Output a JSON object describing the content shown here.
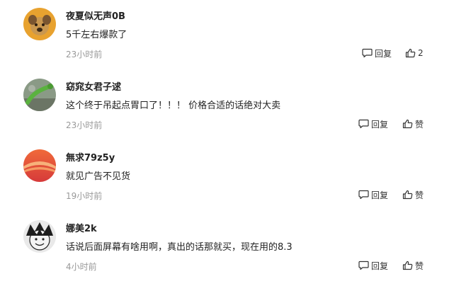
{
  "comments": [
    {
      "username": "夜夏似无声0B",
      "text": "5千左右爆款了",
      "time": "23小时前",
      "reply_label": "回复",
      "like_label": "2"
    },
    {
      "username": "窈窕女君子逑",
      "text": "这个终于吊起点胃口了！！！ 价格合适的话绝对大卖",
      "time": "23小时前",
      "reply_label": "回复",
      "like_label": "赞"
    },
    {
      "username": "無求79z5y",
      "text": "就见广告不见货",
      "time": "19小时前",
      "reply_label": "回复",
      "like_label": "赞"
    },
    {
      "username": "娜美2k",
      "text": "话说后面屏幕有啥用啊，真出的话那就买，现在用的8.3",
      "time": "4小时前",
      "reply_label": "回复",
      "like_label": "赞"
    }
  ],
  "icons": {
    "reply": "comment-bubble-icon",
    "like": "thumbs-up-icon"
  },
  "colors": {
    "text": "#222222",
    "muted": "#999999",
    "action": "#333333"
  }
}
